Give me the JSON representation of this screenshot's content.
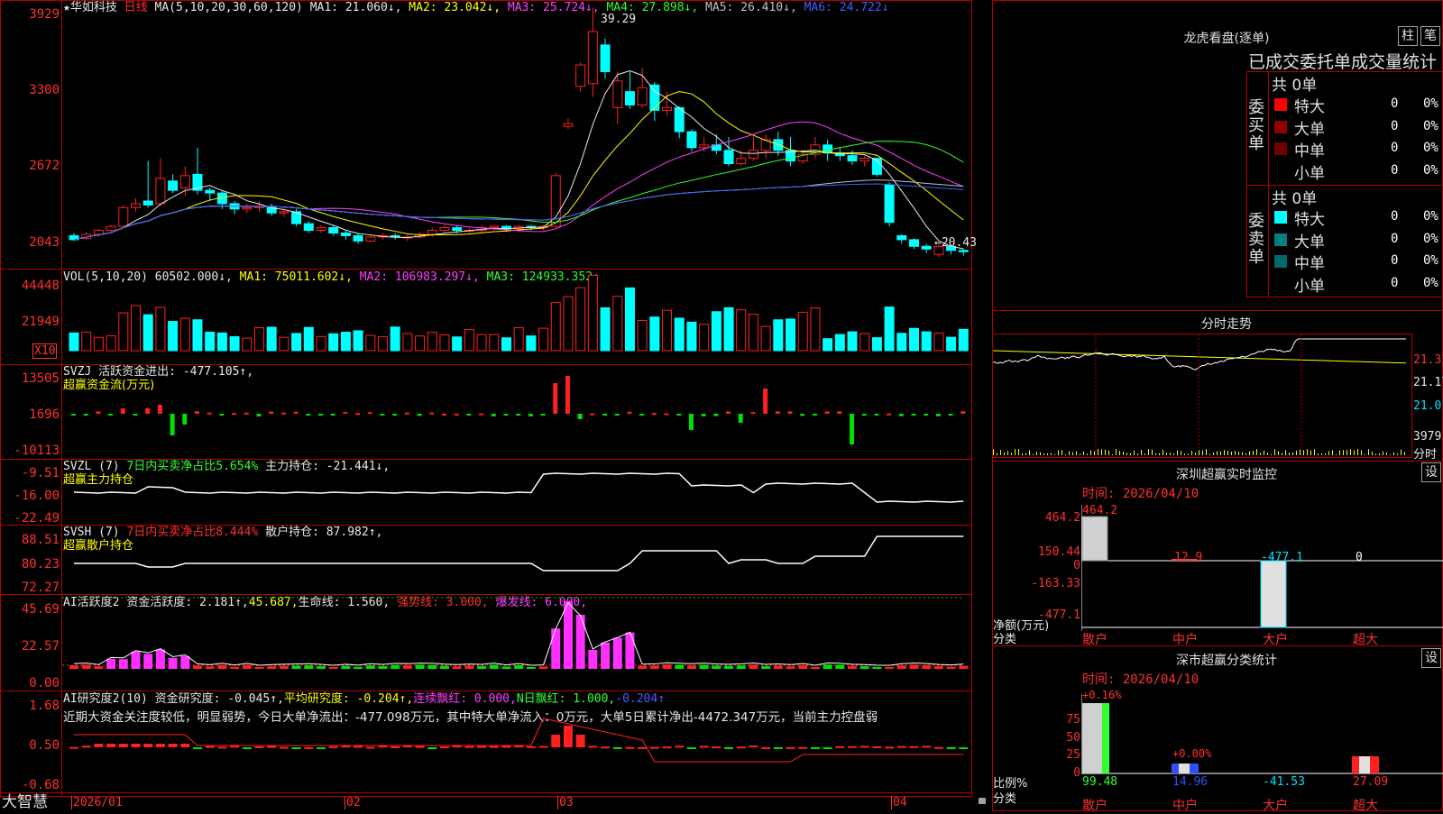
{
  "header": {
    "star": "★",
    "stock_name": "华如科技",
    "period": "日线",
    "ma_label": "MA(5,10,20,30,60,120)",
    "ma1": "MA1: 21.060↓,",
    "ma2": "MA2: 23.042↓,",
    "ma3": "MA3: 25.724↓,",
    "ma4": "MA4: 27.898↓,",
    "ma5": "MA5: 26.410↓,",
    "ma6": "MA6: 24.722↓"
  },
  "price_axis": [
    "3929",
    "3300",
    "2672",
    "2043"
  ],
  "price_marks": {
    "high": "39.29",
    "low": "←20.43"
  },
  "vol": {
    "label": "VOL(5,10,20)",
    "value": "60502.000↓,",
    "ma1": "MA1: 75011.602↓,",
    "ma2": "MA2: 106983.297↓,",
    "ma3": "MA3: 124933.352↓",
    "axis": [
      "44448",
      "21949"
    ],
    "unit": "X10"
  },
  "svzj": {
    "line1": "SVZJ  活跃资金进出: -477.105↑,",
    "line2": "超赢资金流(万元)",
    "axis": [
      "13505",
      "1696",
      "-10113"
    ]
  },
  "svzl": {
    "name": "SVZL (7)",
    "ratio": "7日内买卖净占比5.654%",
    "hold": "主力持仓: -21.441↓,",
    "line2": "超赢主力持仓",
    "axis": [
      "-9.51",
      "-16.00",
      "-22.49"
    ]
  },
  "svsh": {
    "name": "SVSH (7)",
    "ratio": "7日内买卖净占比8.444%",
    "hold": "散户持仓: 87.982↑,",
    "line2": "超赢散户持仓",
    "axis": [
      "88.51",
      "80.23",
      "72.27"
    ]
  },
  "ai_active": {
    "name": "AI活跃度2",
    "a": "资金活跃度: 2.181↑,",
    "b": "45.687,",
    "c": "生命线: 1.560,",
    "d": "强势线: 3.000,",
    "e": "爆发线: 6.000,",
    "axis": [
      "45.69",
      "22.57",
      "0.00"
    ]
  },
  "ai_research": {
    "name": "AI研究度2(10)",
    "a": "资金研究度: -0.045↑,",
    "b": "平均研究度: -0.204↑,",
    "c": "连续飘红: 0.000,",
    "d": "N日飘红: 1.000,",
    "e": "-0.204↑",
    "comment": "近期大资金关注度较低，明显弱势，今日大单净流出：-477.098万元，其中特大单净流入：0万元，大单5日累计净出-4472.347万元，当前主力控盘弱",
    "axis": [
      "1.68",
      "0.50",
      "-0.68"
    ]
  },
  "footer": {
    "brand": "大智慧",
    "dates": [
      "2026/01",
      "02",
      "03",
      "04"
    ]
  },
  "lhb": {
    "title": "龙虎看盘(逐单)",
    "btn_bar": "柱",
    "btn_pen": "笔",
    "stats_title": "已成交委托单成交量统计",
    "buy_label": "委买单",
    "sell_label": "委卖单",
    "buy_total": "共 0单",
    "sell_total": "共 0单",
    "buy_rows": [
      {
        "name": "特大",
        "count": "0",
        "pct": "0%",
        "color": "#ff0000"
      },
      {
        "name": "大单",
        "count": "0",
        "pct": "0%",
        "color": "#900000"
      },
      {
        "name": "中单",
        "count": "0",
        "pct": "0%",
        "color": "#700000"
      },
      {
        "name": "小单",
        "count": "0",
        "pct": "0%",
        "color": "#000000"
      }
    ],
    "sell_rows": [
      {
        "name": "特大",
        "count": "0",
        "pct": "0%",
        "color": "#00ffff"
      },
      {
        "name": "大单",
        "count": "0",
        "pct": "0%",
        "color": "#008080"
      },
      {
        "name": "中单",
        "count": "0",
        "pct": "0%",
        "color": "#006a6a"
      },
      {
        "name": "小单",
        "count": "0",
        "pct": "0%",
        "color": "#000000"
      }
    ]
  },
  "intraday": {
    "title": "分时走势",
    "axis": [
      "21.33",
      "21.17",
      "21.01",
      "3979"
    ],
    "unit": "分时"
  },
  "sz_monitor": {
    "title": "深圳超赢实时监控",
    "btn": "设",
    "time": "时间: 2026/04/10",
    "axis": [
      "464.2",
      "150.44",
      "0",
      "-163.33",
      "-477.1"
    ],
    "ylabel1": "净额(万元)",
    "ylabel2": "分类",
    "categories": [
      "散户",
      "中户",
      "大户",
      "超大"
    ],
    "values": [
      "464.2",
      "12.9",
      "-477.1",
      "0"
    ]
  },
  "sz_class": {
    "title": "深市超赢分类统计",
    "btn": "设",
    "time": "时间: 2026/04/10",
    "axis": [
      "75",
      "50",
      "25",
      "0"
    ],
    "ylabel1": "比例%",
    "ylabel2": "分类",
    "categories": [
      "散户",
      "中户",
      "大户",
      "超大"
    ],
    "top_labels": [
      "+0.16%",
      "+0.00%"
    ],
    "values": [
      "99.48",
      "14.96",
      "-41.53",
      "27.09"
    ]
  }
}
